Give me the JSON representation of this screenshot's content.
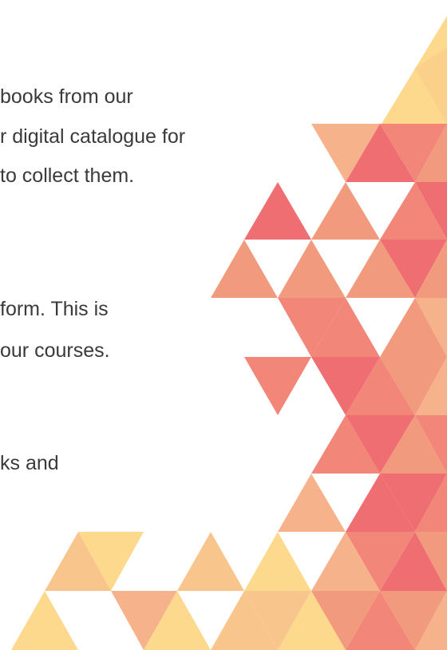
{
  "document": {
    "lines": {
      "line1": "books from our",
      "line2": "r digital catalogue for",
      "line3": "to collect them.",
      "line4": "form. This is",
      "line5": "our courses.",
      "line6": "ks and"
    }
  },
  "decoration": {
    "name": "triangle-mosaic",
    "palette": {
      "yellow": "#FCD98C",
      "light_orange": "#F8C58C",
      "peach": "#F6B28A",
      "salmon": "#F29A7E",
      "coral": "#F28679",
      "pink_red": "#EF6E72",
      "white": "#FFFFFF"
    }
  }
}
